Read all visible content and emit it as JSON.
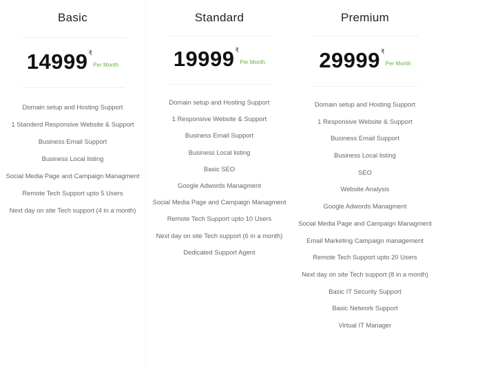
{
  "plans": [
    {
      "name": "Basic",
      "price": "14999",
      "currency": "₹",
      "period": "Per Month",
      "features": [
        "Domain setup and Hosting Support",
        "1 Standerd Responsive Website & Support",
        "Business Email Support",
        "Business Local listing",
        "Social Media Page and Campaign Managment",
        "Remote Tech Support upto 5 Users",
        "Next day on site Tech support (4 in a month)"
      ]
    },
    {
      "name": "Standard",
      "price": "19999",
      "currency": "₹",
      "period": "Per Month",
      "features": [
        "Domain setup and Hosting Support",
        "1 Responsive Website & Support",
        "Business Email Support",
        "Business Local listing",
        "Basic SEO",
        "Google Adwords Managment",
        "Social Media Page and Campaign Managment",
        "Remote Tech Support upto 10 Users",
        "Next day on site Tech support (6 in a month)",
        "Dedicated Support Agent"
      ]
    },
    {
      "name": "Premium",
      "price": "29999",
      "currency": "₹",
      "period": "Per Month",
      "features": [
        "Domain setup and Hosting Support",
        "1 Responsive Website & Support",
        "Business Email Support",
        "Business Local listing",
        "SEO",
        "Website Analysis",
        "Google Adwords Managment",
        "Social Media Page and Campaign Managment",
        "Email Marketing Campaign management",
        "Remote Tech Support upto 20 Users",
        "Next day on site Tech support (8 in a month)",
        "Basic IT Security Support",
        "Basic Network Support",
        "Virtual IT Manager"
      ]
    }
  ],
  "colors": {
    "accent": "#67b23a",
    "price_text": "#111111",
    "feature_text": "#666666"
  }
}
